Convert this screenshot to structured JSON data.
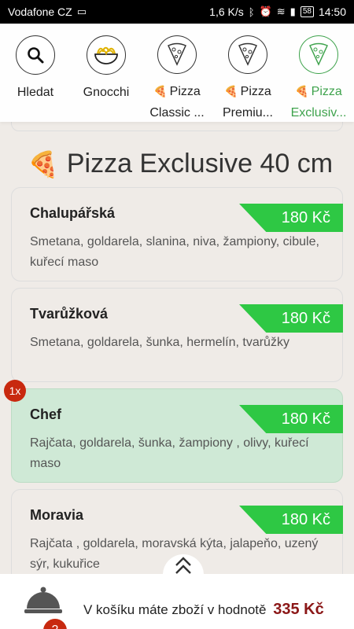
{
  "statusbar": {
    "carrier": "Vodafone CZ",
    "speed": "1,6 K/s",
    "battery": "58",
    "time": "14:50"
  },
  "categories": [
    {
      "label": "Hledat",
      "icon": "search-icon",
      "active": false
    },
    {
      "label": "Gnocchi",
      "icon": "noodle-bowl-icon",
      "active": false
    },
    {
      "label_line1": "Pizza",
      "label_line2": "Classic ...",
      "icon": "pizza-slice-icon",
      "active": false
    },
    {
      "label_line1": "Pizza",
      "label_line2": "Premiu...",
      "icon": "pizza-slice-icon",
      "active": false
    },
    {
      "label_line1": "Pizza",
      "label_line2": "Exclusiv...",
      "icon": "pizza-slice-icon",
      "active": true
    }
  ],
  "section": {
    "emoji": "🍕",
    "title": "Pizza Exclusive 40 cm"
  },
  "items": [
    {
      "name": "Chalupářská",
      "price": "180 Kč",
      "description": "Smetana, goldarela, slanina, niva, žampiony, cibule, kuřecí maso"
    },
    {
      "name": "Tvarůžková",
      "price": "180 Kč",
      "description": "Smetana, goldarela, šunka, hermelín, tvarůžky"
    },
    {
      "name": "Chef",
      "price": "180 Kč",
      "description": "Rajčata, goldarela, šunka, žampiony , olivy, kuřecí maso",
      "quantity": "1x"
    },
    {
      "name": "Moravia",
      "price": "180 Kč",
      "description": "Rajčata , goldarela, moravská kýta, jalapeňo, uzený sýr, kukuřice"
    }
  ],
  "cart": {
    "text": "V košíku máte zboží v hodnotě",
    "total": "335 Kč",
    "count": "2"
  },
  "colors": {
    "accent_green": "#2ec844",
    "active_green": "#3fa34d",
    "badge_red": "#c8290f",
    "selected_bg": "#cfe9d6"
  }
}
